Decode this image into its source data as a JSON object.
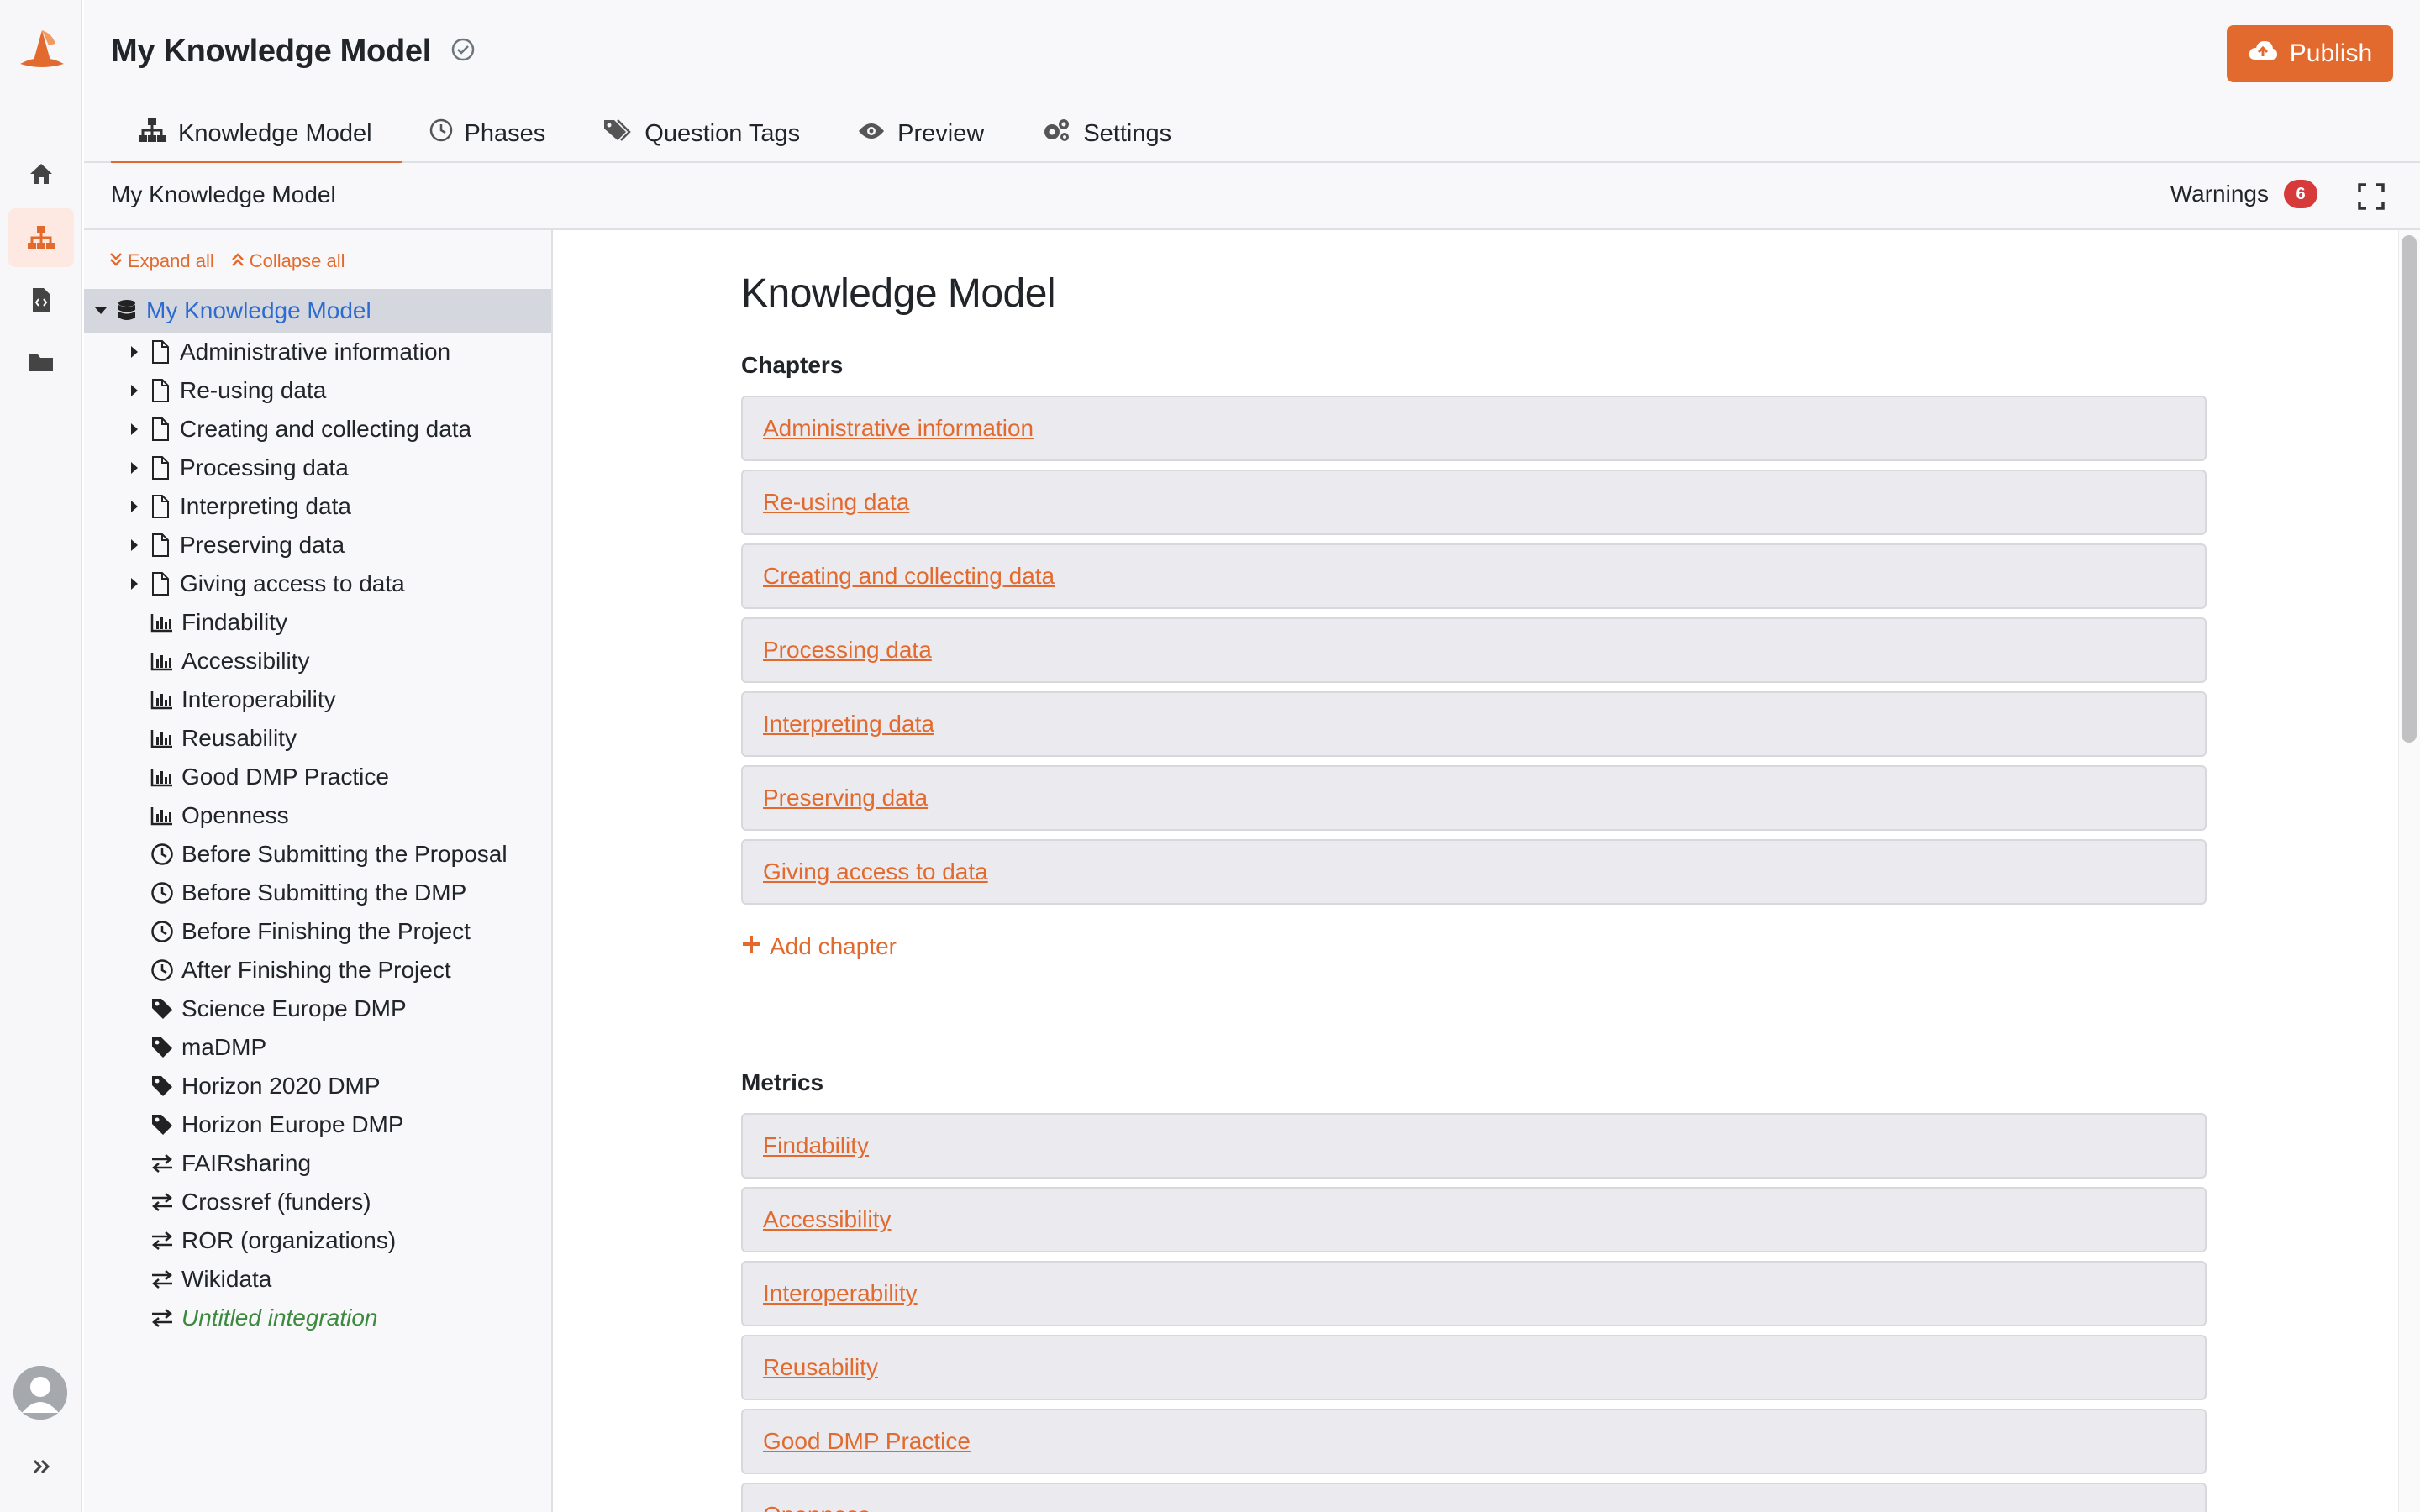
{
  "app": {
    "title": "My Knowledge Model",
    "accent_color": "#e36a2e",
    "rail_icons": [
      "home-icon",
      "sitemap-icon",
      "document-code-icon",
      "folder-icon"
    ]
  },
  "header": {
    "publish_label": "Publish",
    "tabs": [
      {
        "label": "Knowledge Model",
        "icon": "sitemap-icon",
        "active": true
      },
      {
        "label": "Phases",
        "icon": "clock-icon"
      },
      {
        "label": "Question Tags",
        "icon": "tags-icon"
      },
      {
        "label": "Preview",
        "icon": "eye-icon"
      },
      {
        "label": "Settings",
        "icon": "gears-icon"
      }
    ]
  },
  "subbar": {
    "breadcrumb": "My Knowledge Model",
    "warnings_label": "Warnings",
    "warnings_count": "6"
  },
  "tree": {
    "expand_all": "Expand all",
    "collapse_all": "Collapse all",
    "root": "My Knowledge Model",
    "items": [
      {
        "label": "Administrative information",
        "icon": "file-icon",
        "expandable": true
      },
      {
        "label": "Re-using data",
        "icon": "file-icon",
        "expandable": true
      },
      {
        "label": "Creating and collecting data",
        "icon": "file-icon",
        "expandable": true
      },
      {
        "label": "Processing data",
        "icon": "file-icon",
        "expandable": true
      },
      {
        "label": "Interpreting data",
        "icon": "file-icon",
        "expandable": true
      },
      {
        "label": "Preserving data",
        "icon": "file-icon",
        "expandable": true
      },
      {
        "label": "Giving access to data",
        "icon": "file-icon",
        "expandable": true
      },
      {
        "label": "Findability",
        "icon": "chart-icon"
      },
      {
        "label": "Accessibility",
        "icon": "chart-icon"
      },
      {
        "label": "Interoperability",
        "icon": "chart-icon"
      },
      {
        "label": "Reusability",
        "icon": "chart-icon"
      },
      {
        "label": "Good DMP Practice",
        "icon": "chart-icon"
      },
      {
        "label": "Openness",
        "icon": "chart-icon"
      },
      {
        "label": "Before Submitting the Proposal",
        "icon": "clock-icon"
      },
      {
        "label": "Before Submitting the DMP",
        "icon": "clock-icon"
      },
      {
        "label": "Before Finishing the Project",
        "icon": "clock-icon"
      },
      {
        "label": "After Finishing the Project",
        "icon": "clock-icon"
      },
      {
        "label": "Science Europe DMP",
        "icon": "tag-icon"
      },
      {
        "label": "maDMP",
        "icon": "tag-icon"
      },
      {
        "label": "Horizon 2020 DMP",
        "icon": "tag-icon"
      },
      {
        "label": "Horizon Europe DMP",
        "icon": "tag-icon"
      },
      {
        "label": "FAIRsharing",
        "icon": "exchange-icon"
      },
      {
        "label": "Crossref (funders)",
        "icon": "exchange-icon"
      },
      {
        "label": "ROR (organizations)",
        "icon": "exchange-icon"
      },
      {
        "label": "Wikidata",
        "icon": "exchange-icon"
      },
      {
        "label": "Untitled integration",
        "icon": "exchange-icon",
        "untitled": true
      }
    ]
  },
  "main": {
    "heading": "Knowledge Model",
    "chapters_title": "Chapters",
    "chapters": [
      "Administrative information",
      "Re-using data",
      "Creating and collecting data",
      "Processing data",
      "Interpreting data",
      "Preserving data",
      "Giving access to data"
    ],
    "add_chapter": "Add chapter",
    "metrics_title": "Metrics",
    "metrics": [
      "Findability",
      "Accessibility",
      "Interoperability",
      "Reusability",
      "Good DMP Practice",
      "Openness"
    ]
  }
}
